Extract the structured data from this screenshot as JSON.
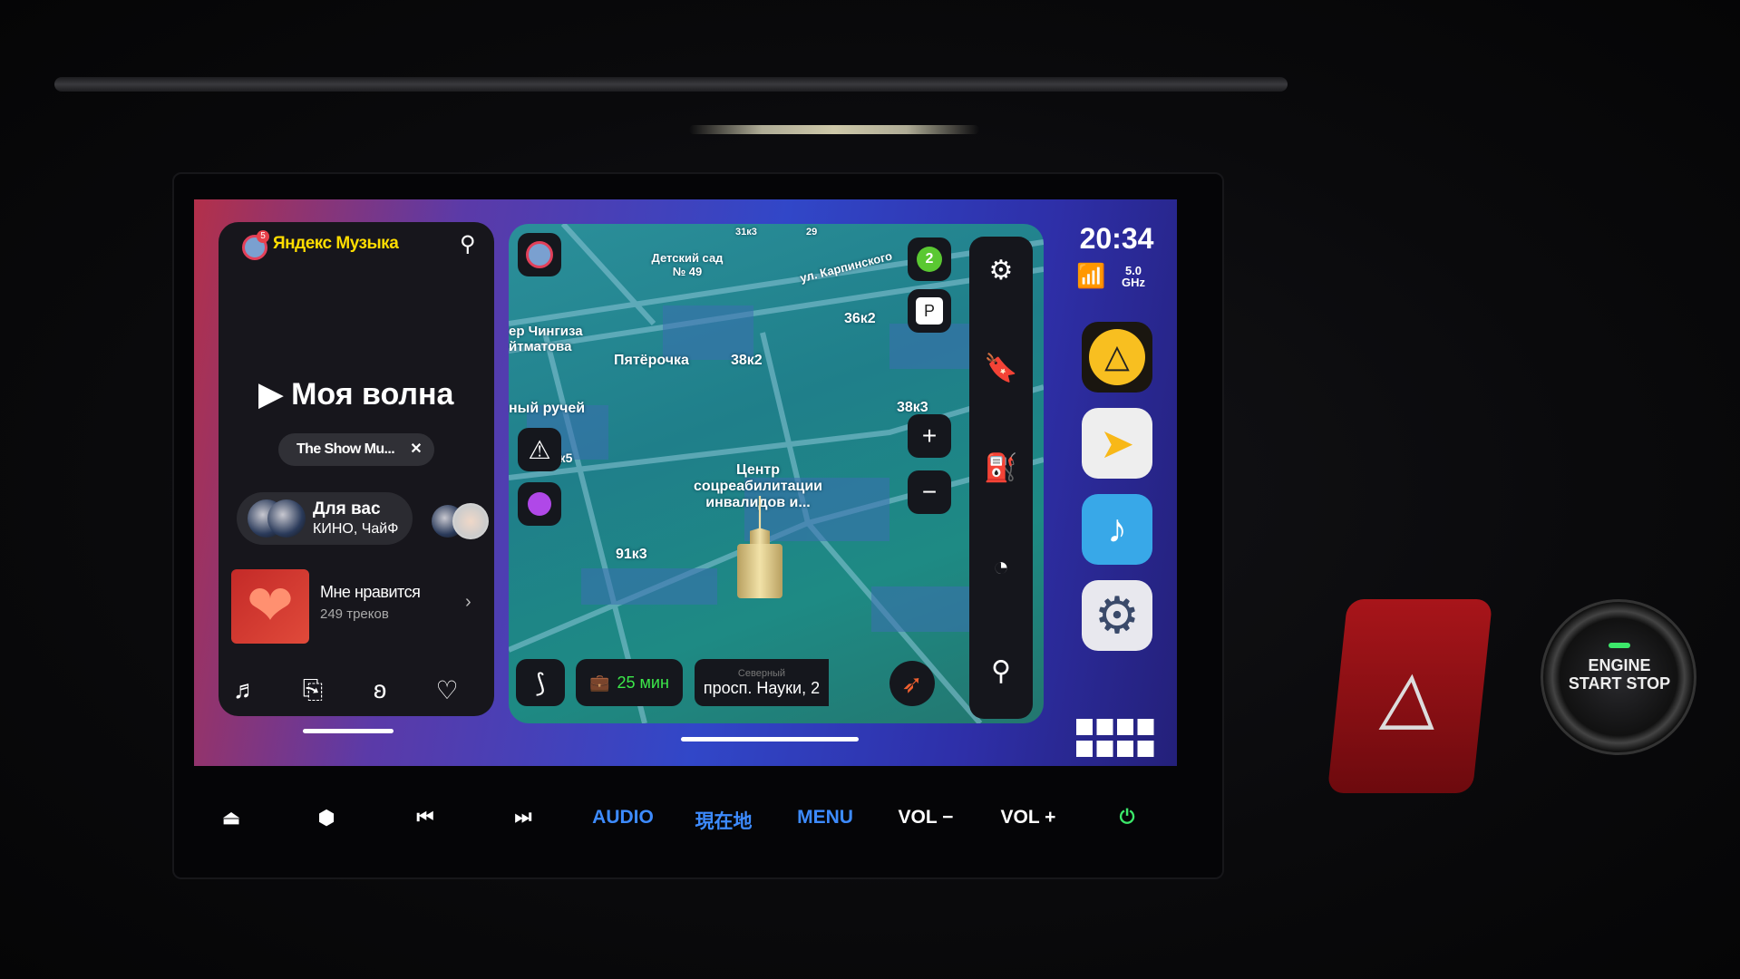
{
  "music": {
    "app_logo": "Яндекс Музыка",
    "badge": "5",
    "title": "Моя волна",
    "chip": "The Show Mu...",
    "for_you": "Для вас",
    "for_you_sub": "КИНО, ЧайФ",
    "liked": "Мне нравится",
    "liked_count": "249 треков"
  },
  "map": {
    "labels": {
      "kindergarten": "Детский сад № 49",
      "street": "ул. Карпинского",
      "aitmatov": "ер Чингиза йтматова",
      "pyaterochka": "Пятёрочка",
      "b38k2": "38к2",
      "b36k2": "36к2",
      "b38k3": "38к3",
      "ruchey": "ный ручей",
      "b91k5": "91к5",
      "center": "Центр соцреабилитации инвалидов и...",
      "b91k3": "91к3",
      "b31k3": "31к3",
      "b29": "29"
    },
    "traffic_level": "2",
    "parking": "P",
    "eta": "25 мин",
    "address_hint": "Северный",
    "address": "просп. Науки, 2",
    "zoom_in": "+",
    "zoom_out": "−"
  },
  "status": {
    "time": "20:34",
    "wifi_band": "5.0 GHz"
  },
  "hardware": {
    "buttons": [
      "⏏",
      "⬢",
      "⏮",
      "⏭",
      "AUDIO",
      "現在地",
      "MENU",
      "VOL −",
      "VOL +",
      "⏻"
    ]
  },
  "engine": {
    "label": "ENGINE START STOP"
  },
  "colors": {
    "yandex_yellow": "#ffdd00",
    "eta_green": "#3ce84a",
    "hw_blue": "#3d8bff",
    "power_green": "#3ce86a"
  }
}
